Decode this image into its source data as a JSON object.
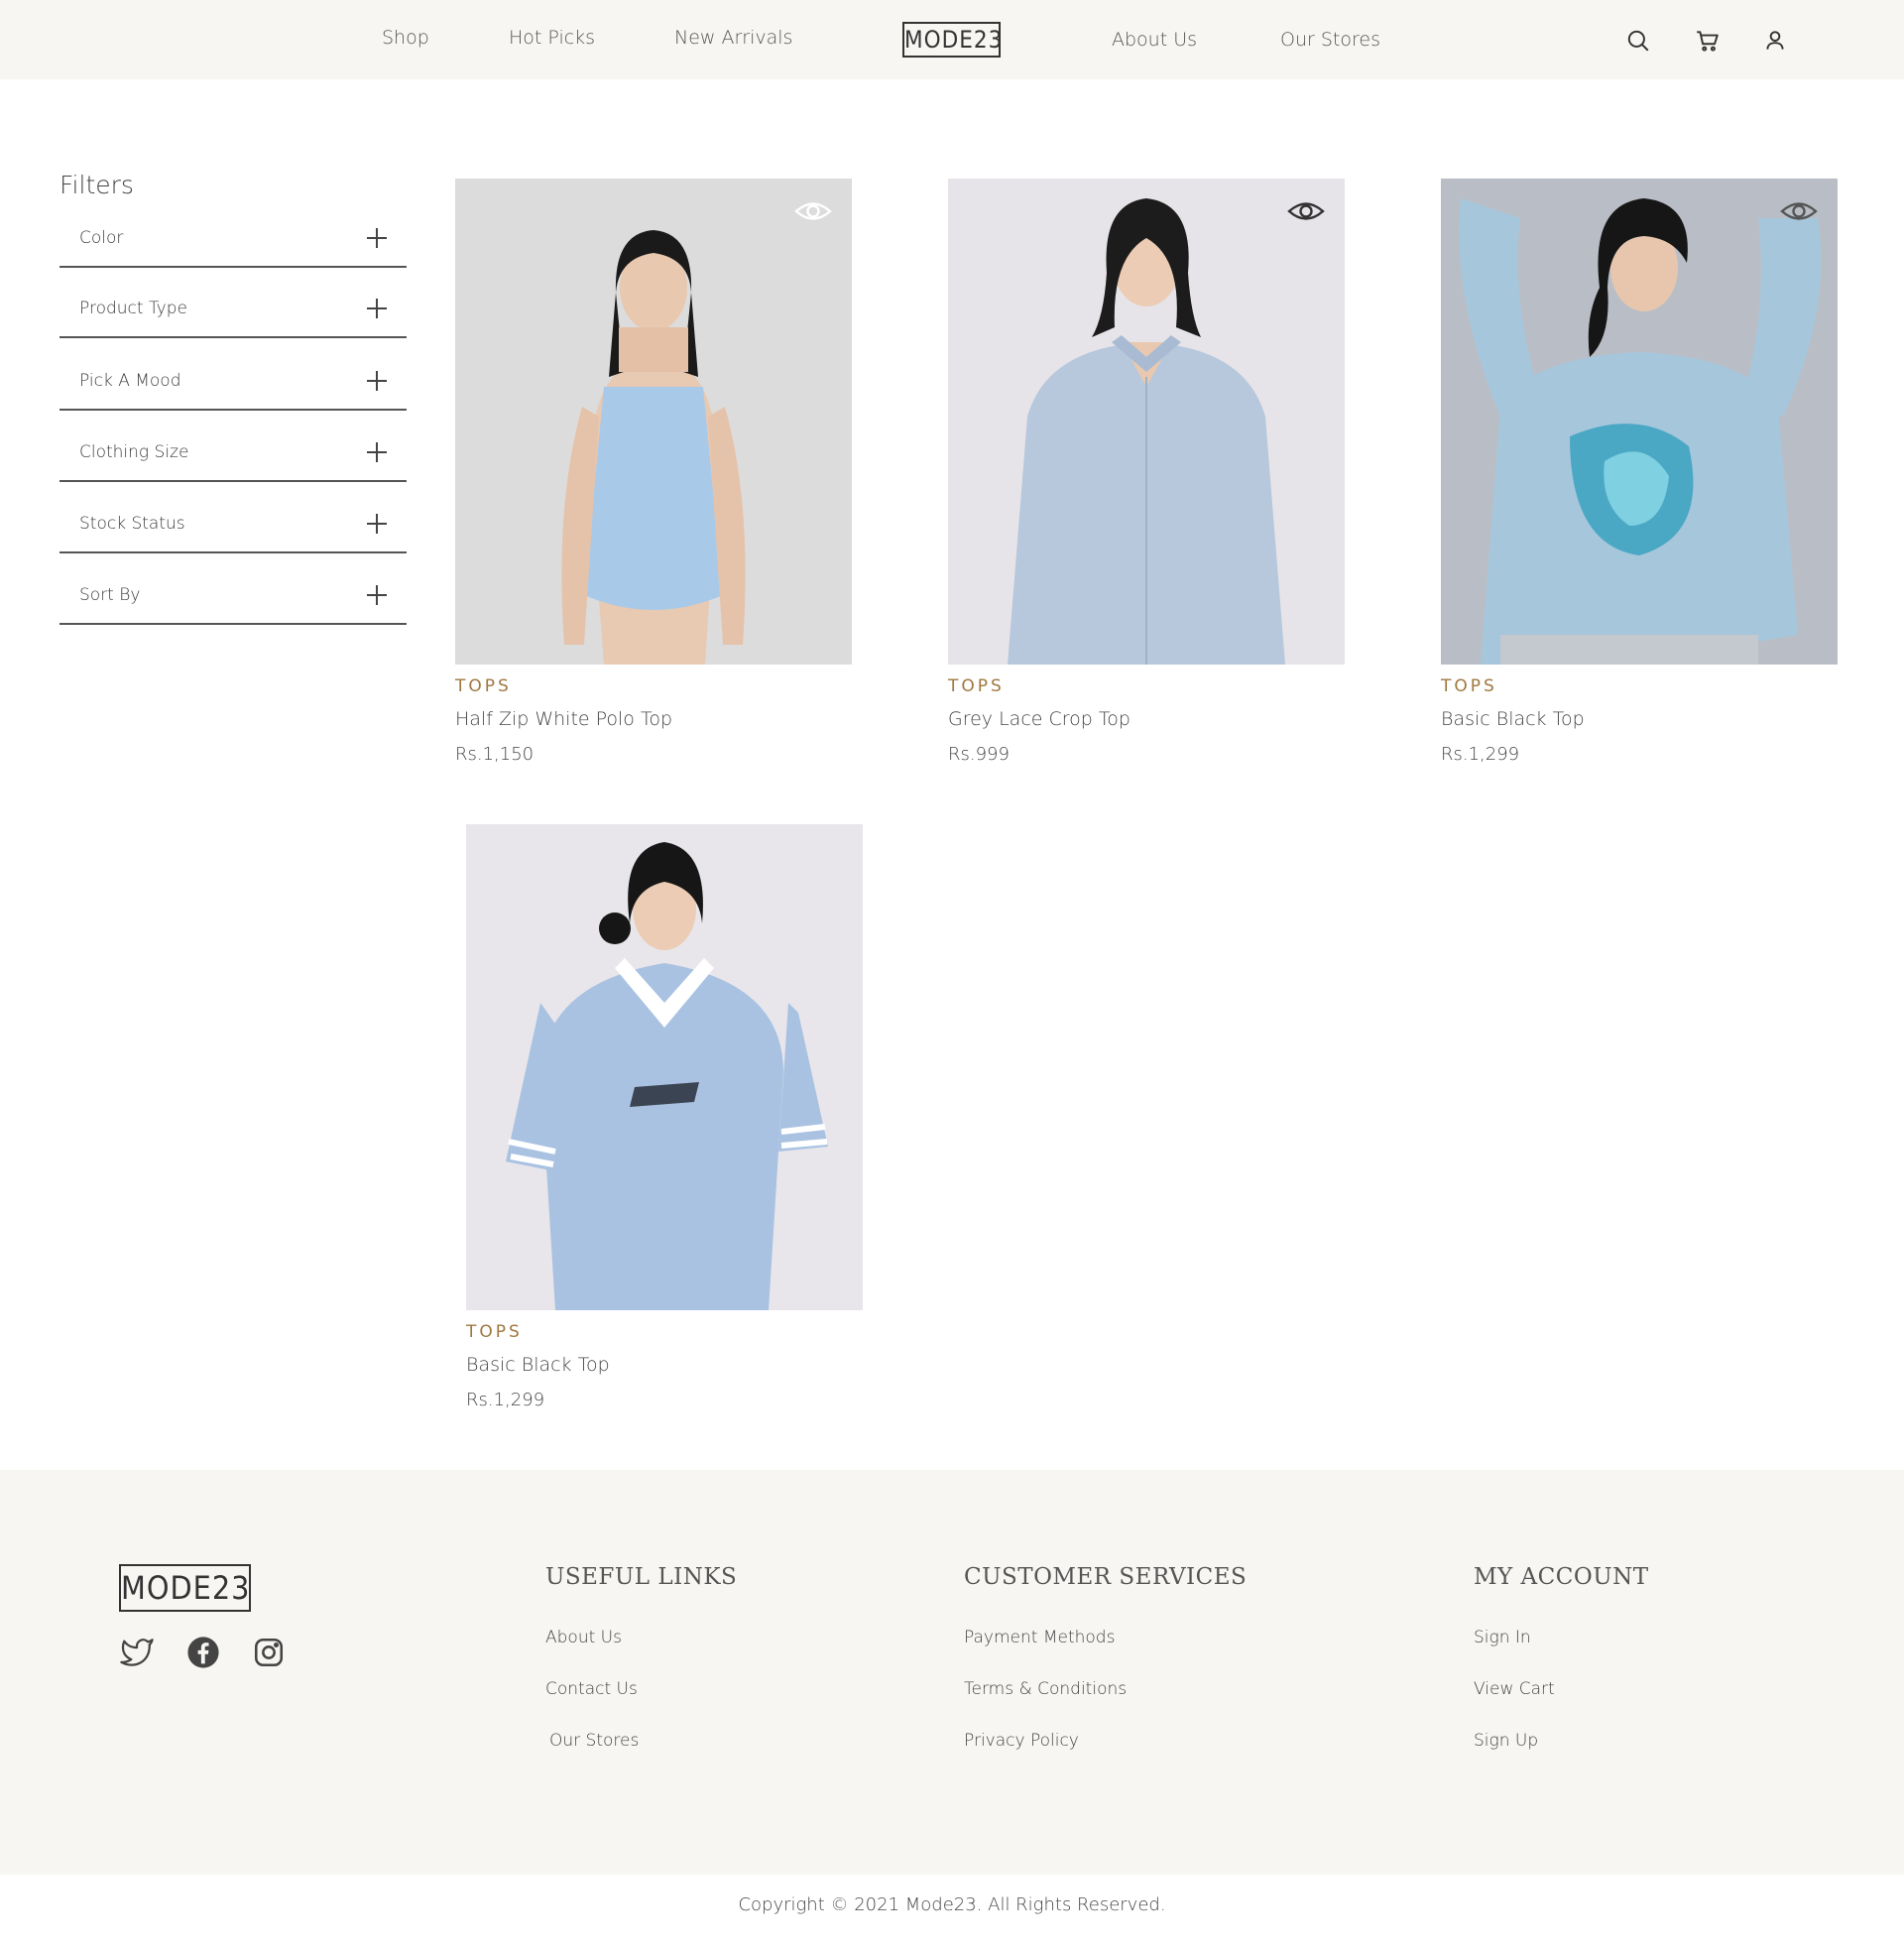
{
  "header": {
    "nav_left": [
      "Shop",
      "Hot Picks",
      "New Arrivals"
    ],
    "logo": "MODE23",
    "nav_right": [
      "About Us",
      "Our Stores"
    ],
    "icons": [
      "search-icon",
      "cart-icon",
      "user-icon"
    ]
  },
  "filters": {
    "title": "Filters",
    "items": [
      "Color",
      "Product Type",
      "Pick A Mood",
      "Clothing Size",
      "Stock Status",
      "Sort By"
    ]
  },
  "products": [
    {
      "category": "TOPS",
      "name": "Half Zip White Polo Top",
      "price": "Rs.1,150",
      "quick_view_icon": "eye-icon"
    },
    {
      "category": "TOPS",
      "name": "Grey Lace Crop Top",
      "price": "Rs.999",
      "quick_view_icon": "eye-icon"
    },
    {
      "category": "TOPS",
      "name": "Basic Black Top",
      "price": "Rs.1,299",
      "quick_view_icon": "eye-icon"
    },
    {
      "category": "TOPS",
      "name": "Basic Black Top",
      "price": "Rs.1,299"
    }
  ],
  "footer": {
    "logo": "MODE23",
    "social_icons": [
      "twitter-icon",
      "facebook-icon",
      "instagram-icon"
    ],
    "useful_links": {
      "title": "USEFUL LINKS",
      "links": [
        "About Us",
        "Contact Us",
        "Our Stores"
      ]
    },
    "customer_services": {
      "title": "CUSTOMER SERVICES",
      "links": [
        "Payment Methods",
        "Terms & Conditions",
        "Privacy Policy"
      ]
    },
    "my_account": {
      "title": "MY ACCOUNT",
      "links": [
        "Sign In",
        "View Cart",
        "Sign Up"
      ]
    },
    "copyright": "Copyright © 2021 Mode23. All Rights Reserved."
  },
  "colors": {
    "header_bg": "#f8f6f3",
    "category_accent": "#a0773f",
    "text": "#3a3a3a"
  }
}
